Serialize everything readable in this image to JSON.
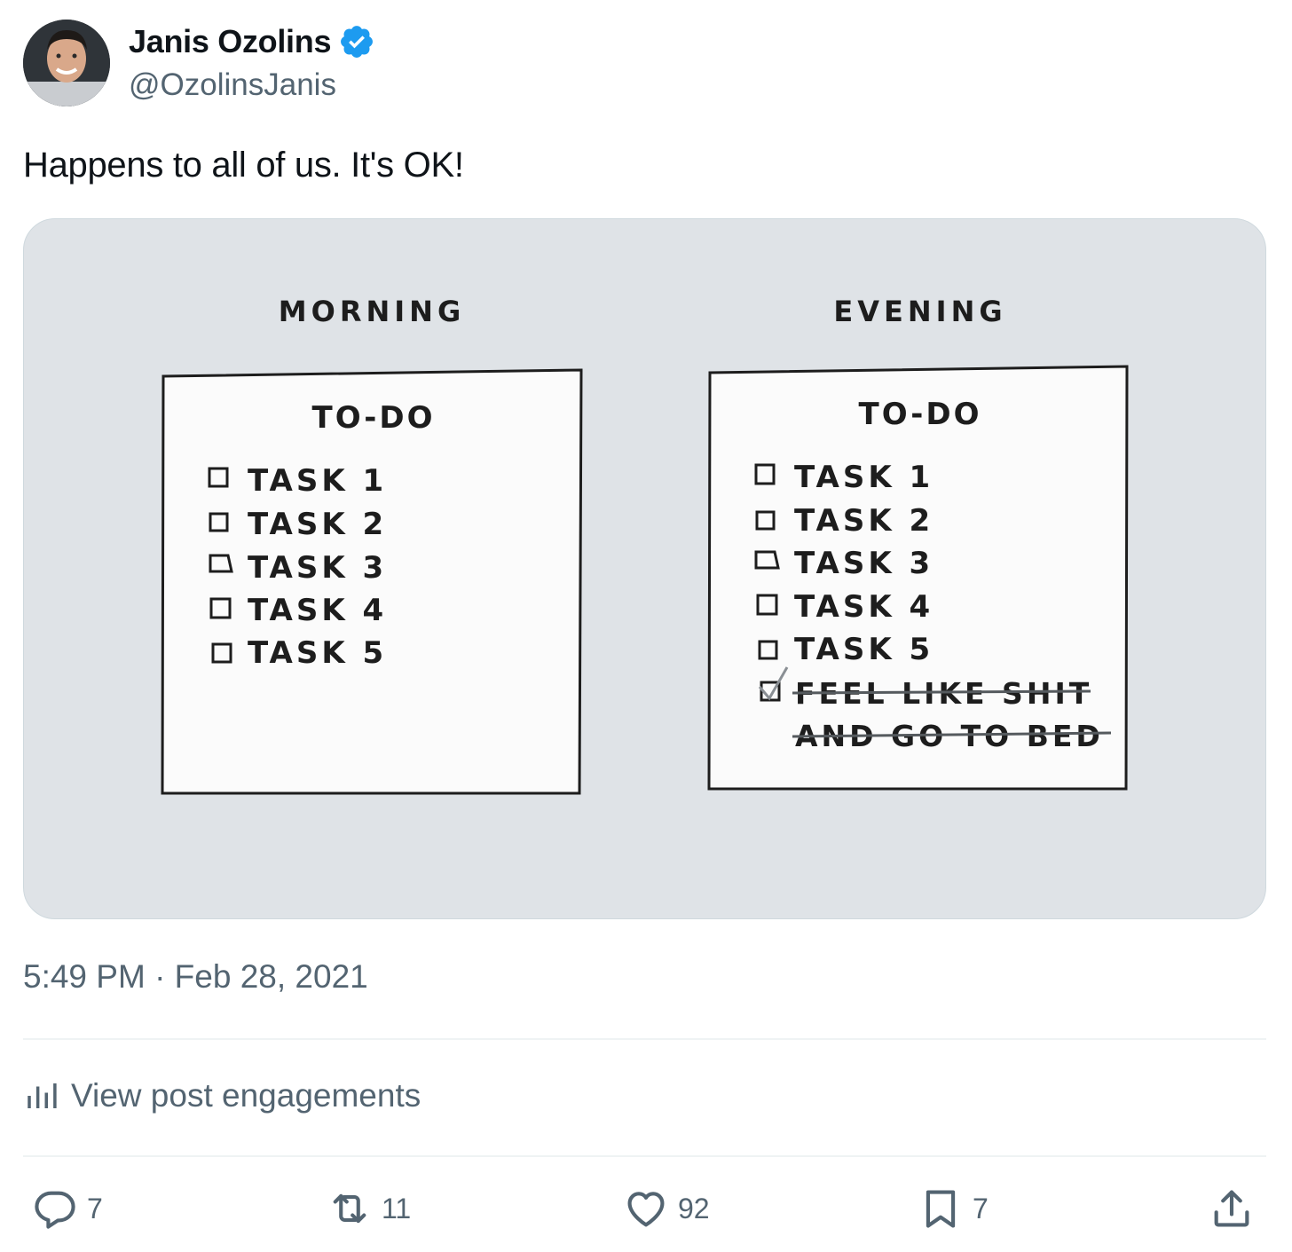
{
  "author": {
    "display_name": "Janis Ozolins",
    "handle": "@OzolinsJanis",
    "verified": true
  },
  "tweet": {
    "text": "Happens to all of us. It's OK!",
    "timestamp": "5:49 PM · Feb 28, 2021"
  },
  "image": {
    "left_panel": {
      "heading": "MORNING",
      "list_title": "TO-DO",
      "tasks": [
        "TASK 1",
        "TASK 2",
        "TASK 3",
        "TASK 4",
        "TASK 5"
      ]
    },
    "right_panel": {
      "heading": "EVENING",
      "list_title": "TO-DO",
      "tasks": [
        "TASK 1",
        "TASK 2",
        "TASK 3",
        "TASK 4",
        "TASK 5"
      ],
      "done_item_line1": "FEEL LIKE SHIT",
      "done_item_line2": "AND GO TO BED"
    }
  },
  "engagements": {
    "label": "View post engagements"
  },
  "actions": {
    "replies": "7",
    "reposts": "11",
    "likes": "92",
    "bookmarks": "7"
  },
  "icons": {
    "verified": "verified-badge-icon",
    "analytics": "bar-chart-icon",
    "reply": "speech-bubble-icon",
    "repost": "repost-arrows-icon",
    "like": "heart-icon",
    "bookmark": "bookmark-icon",
    "share": "share-upload-icon"
  },
  "colors": {
    "text_primary": "#0f1419",
    "text_secondary": "#536471",
    "verified_blue": "#1d9bf0",
    "media_background": "#dfe3e7"
  }
}
